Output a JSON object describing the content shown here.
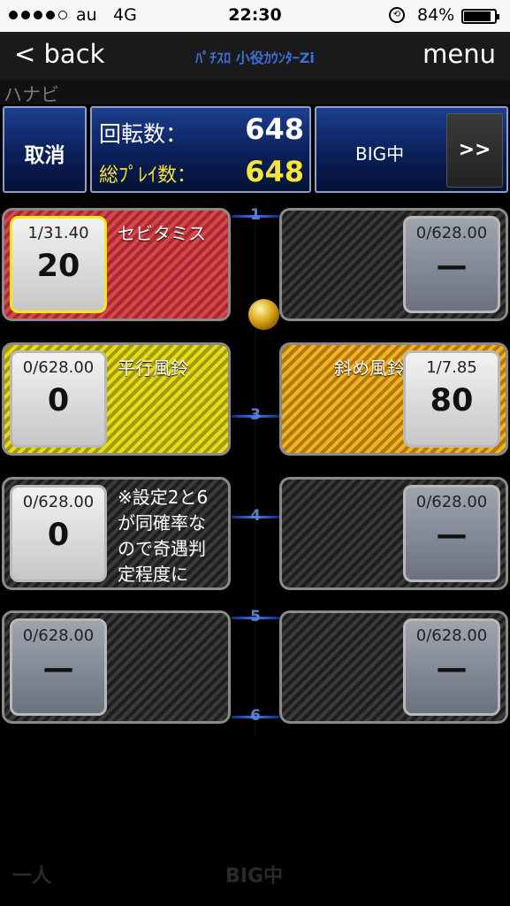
{
  "status": {
    "carrier": "au",
    "network": "4G",
    "time": "22:30",
    "battery": "84%",
    "battery_level": 0.84
  },
  "nav": {
    "back": "< back",
    "title": "ﾊﾟﾁｽﾛ 小役ｶｳﾝﾀｰZi",
    "menu": "menu"
  },
  "machine_name": "ハナビ",
  "header": {
    "cancel": "取消",
    "spins_label": "回転数：",
    "spins_value": "648",
    "total_label": "総ﾌﾟﾚｲ数：",
    "total_value": "648",
    "mode": "BIG中",
    "next": ">>"
  },
  "rows": [
    {
      "marker": "1",
      "left": {
        "name": "セビタミス",
        "prob": "1/31.40",
        "count": "20"
      },
      "right": {
        "prob": "0/628.00",
        "count": "—"
      }
    },
    {
      "marker": "3",
      "left": {
        "name": "平行風鈴",
        "prob": "0/628.00",
        "count": "0"
      },
      "right": {
        "name": "斜め風鈴",
        "prob": "1/7.85",
        "count": "80"
      }
    },
    {
      "marker": "4",
      "left": {
        "note_lines": [
          "※設定2と6",
          "が同確率な",
          "ので奇遇判",
          "定程度に"
        ],
        "prob": "0/628.00",
        "count": "0"
      },
      "right": {
        "prob": "0/628.00",
        "count": "—"
      }
    },
    {
      "marker": "5",
      "left": {
        "prob": "0/628.00",
        "count": "—"
      },
      "right": {
        "prob": "0/628.00",
        "count": "—"
      }
    }
  ],
  "marker_6": "6",
  "footer": {
    "left_ghost": "一人",
    "center_ghost": "BIG中"
  },
  "colors": {
    "header_blue": "#0a1f5a",
    "yellow_text": "#f5e43a",
    "red_panel": "#d9474d",
    "yellow_panel": "#e5dc1a",
    "orange_panel": "#f0b323",
    "highlight": "#f1ea1b"
  }
}
